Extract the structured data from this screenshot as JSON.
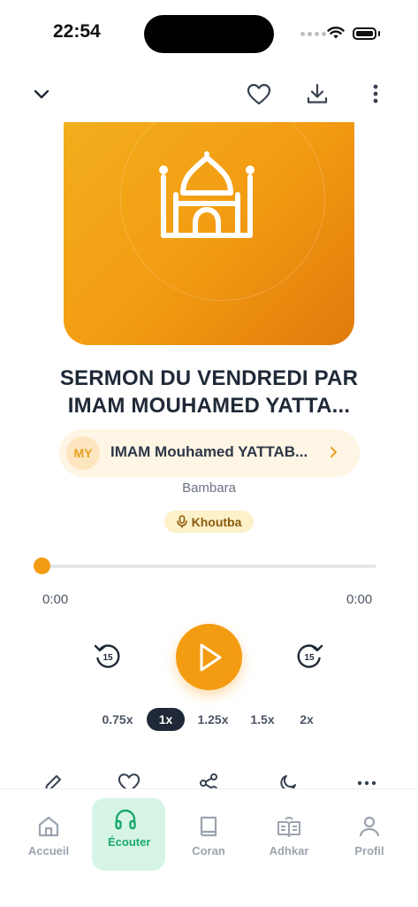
{
  "status": {
    "time": "22:54"
  },
  "topbar": {
    "collapse": "chevron-down-icon",
    "favorite": "heart-icon",
    "download": "download-icon",
    "more": "more-vertical-icon"
  },
  "artwork": {
    "icon": "mosque-icon",
    "accent": "#f39c12"
  },
  "track": {
    "title_line1": "SERMON DU VENDREDI PAR",
    "title_line2": "IMAM MOUHAMED YATTA...",
    "author_initials": "MY",
    "author_name": "IMAM Mouhamed YATTAB...",
    "language": "Bambara",
    "category": "Khoutba"
  },
  "player": {
    "current_time": "0:00",
    "total_time": "0:00",
    "progress": 0,
    "rewind_seconds": "15",
    "forward_seconds": "15",
    "speeds": [
      "0.75x",
      "1x",
      "1.25x",
      "1.5x",
      "2x"
    ],
    "selected_speed": "1x"
  },
  "actions": [
    "pencil-icon",
    "heart-icon",
    "share-icon",
    "moon-icon",
    "more-horizontal-icon"
  ],
  "tabs": [
    {
      "label": "Accueil",
      "icon": "home-icon"
    },
    {
      "label": "Écouter",
      "icon": "headphones-icon"
    },
    {
      "label": "Coran",
      "icon": "book-icon"
    },
    {
      "label": "Adhkar",
      "icon": "open-book-icon"
    },
    {
      "label": "Profil",
      "icon": "user-icon"
    }
  ],
  "active_tab": "Écouter",
  "colors": {
    "accent": "#f39c12",
    "active_tab_bg": "#d7f5e6",
    "active_tab_text": "#1aa86a",
    "dark": "#1f2937"
  }
}
